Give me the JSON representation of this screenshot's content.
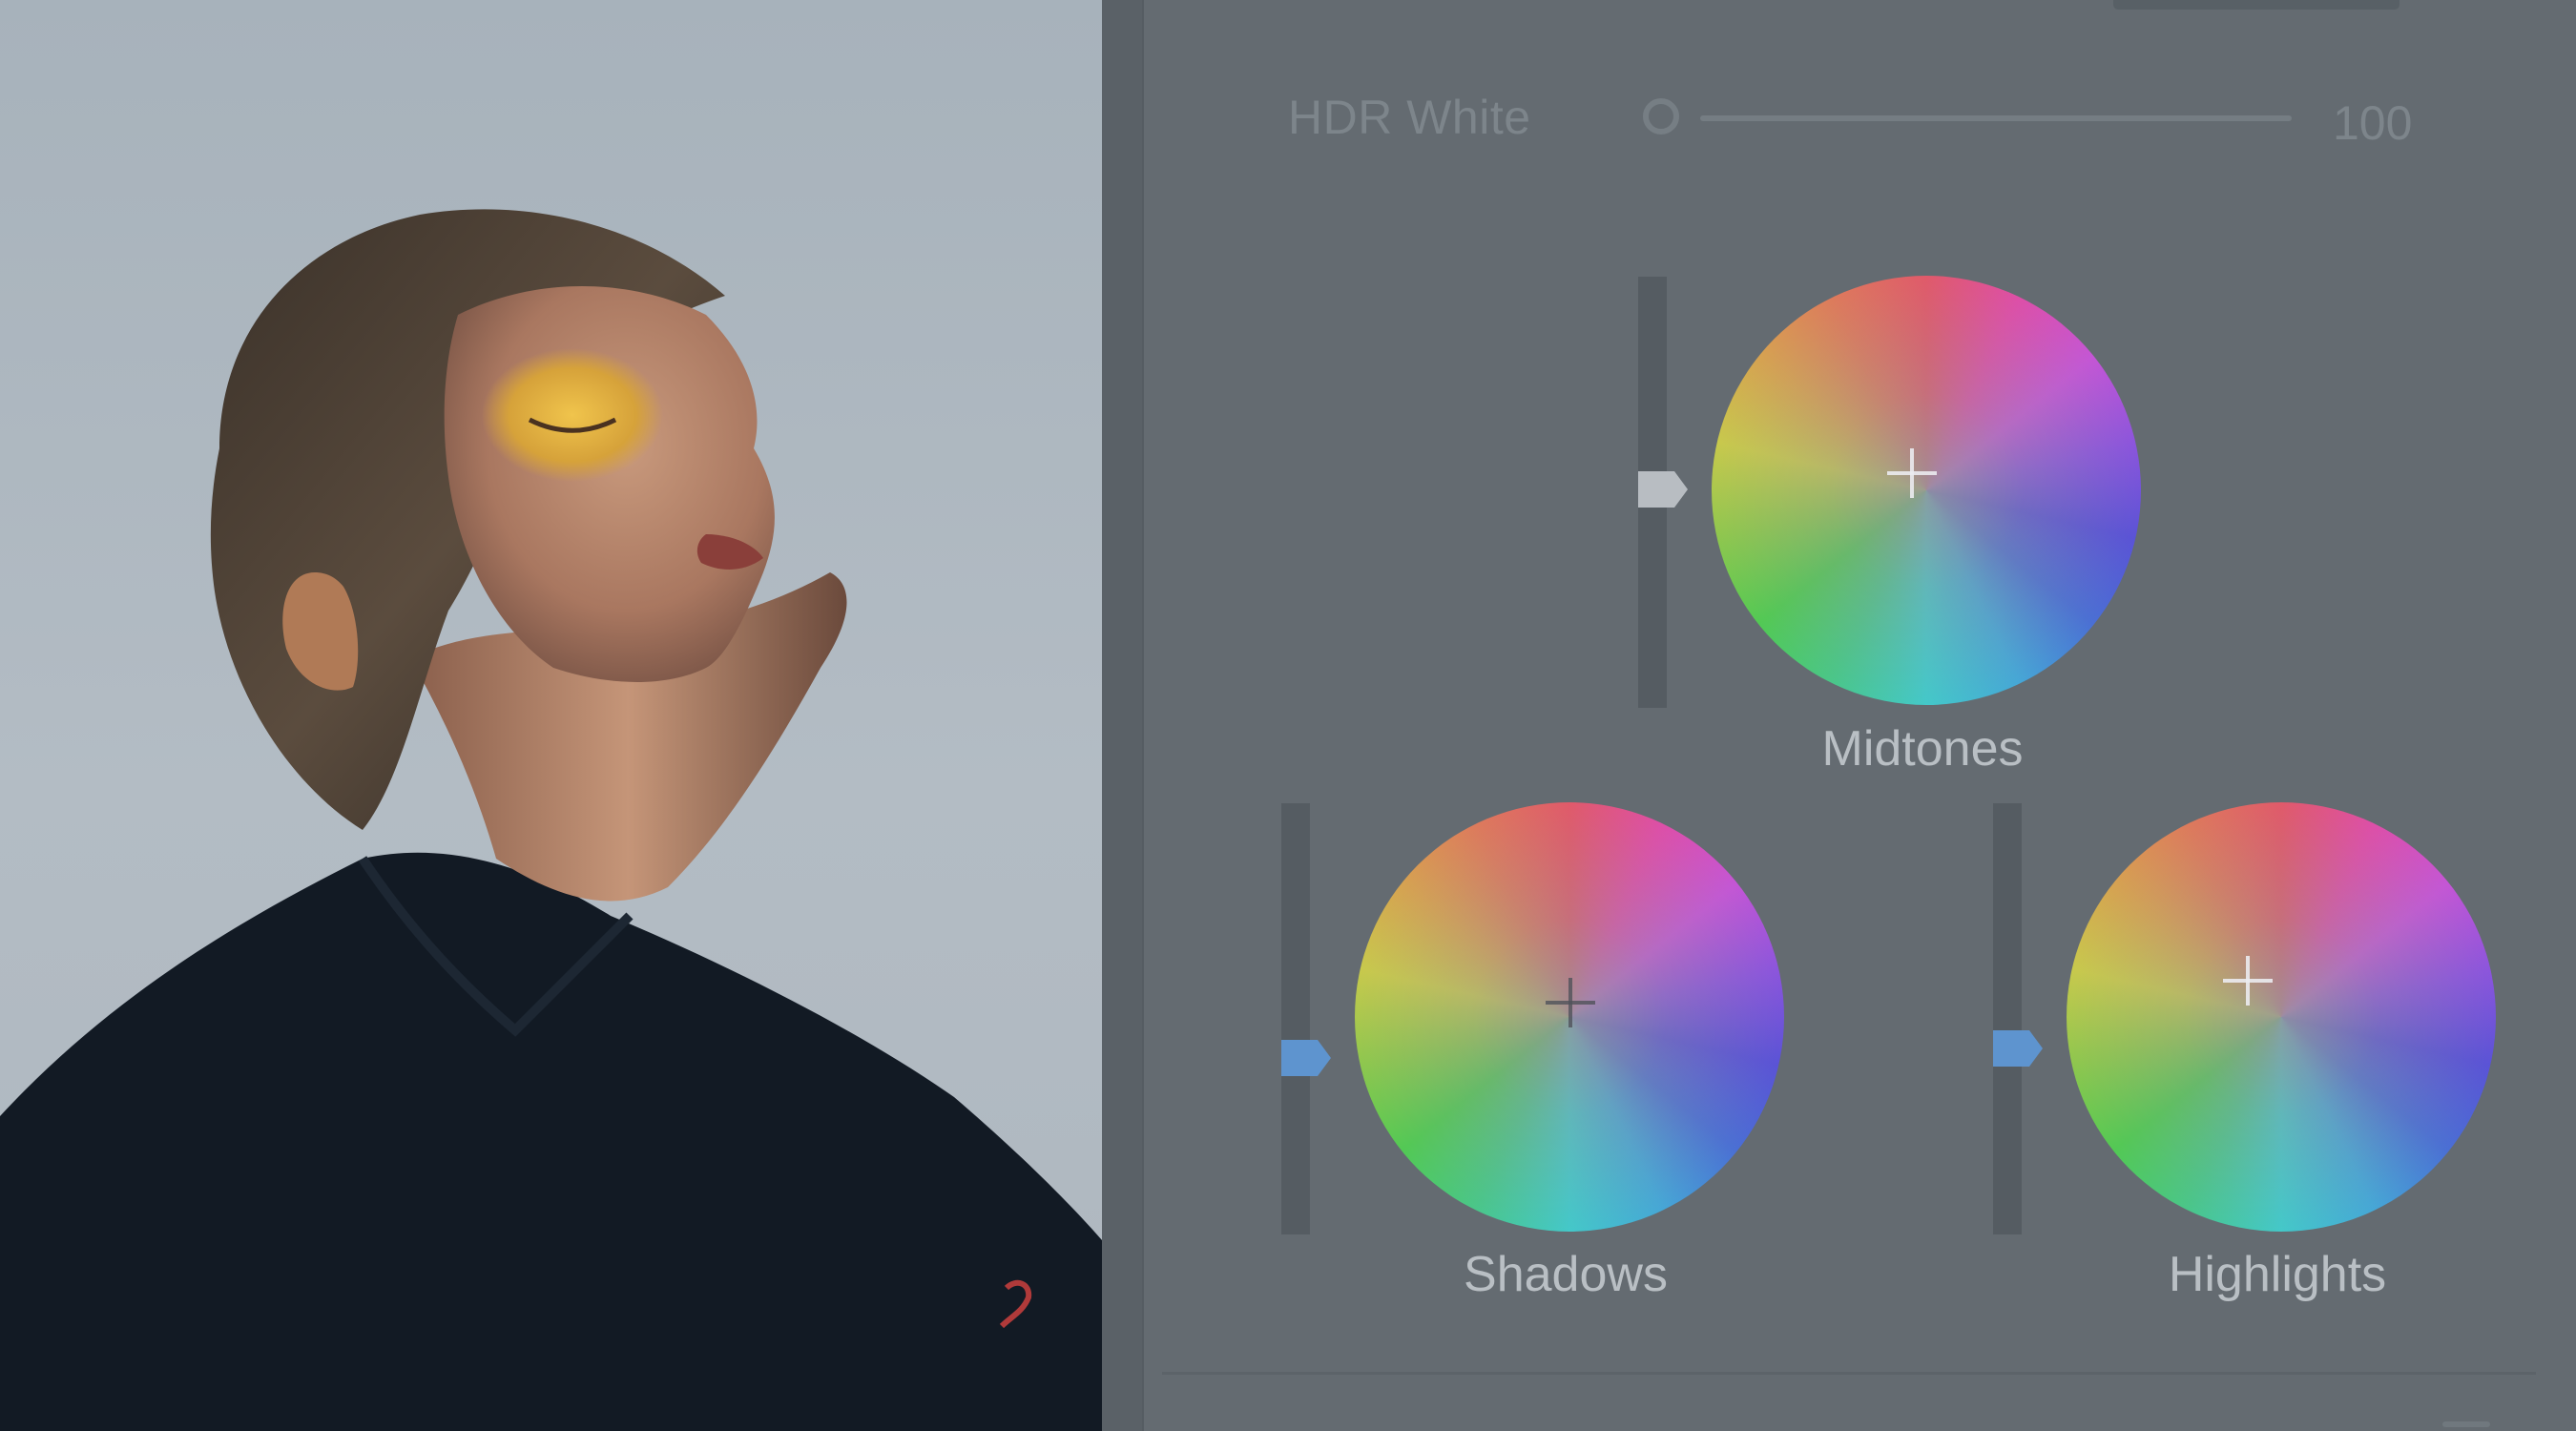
{
  "photo": {
    "subject": "portrait-with-gold-eyeshadow"
  },
  "hdr": {
    "label": "HDR White",
    "value": "100",
    "level": 0.0
  },
  "wheels": {
    "midtones": {
      "label": "Midtones",
      "luminance": 0.5
    },
    "shadows": {
      "label": "Shadows",
      "luminance": 0.4
    },
    "highlights": {
      "label": "Highlights",
      "luminance": 0.42
    }
  },
  "colors": {
    "panel_bg": "#646b71",
    "label_text": "#b9bfc4",
    "muted_text": "#7d858b",
    "accent_thumb": "#5e94cf",
    "neutral_thumb": "#b8bdc2"
  }
}
